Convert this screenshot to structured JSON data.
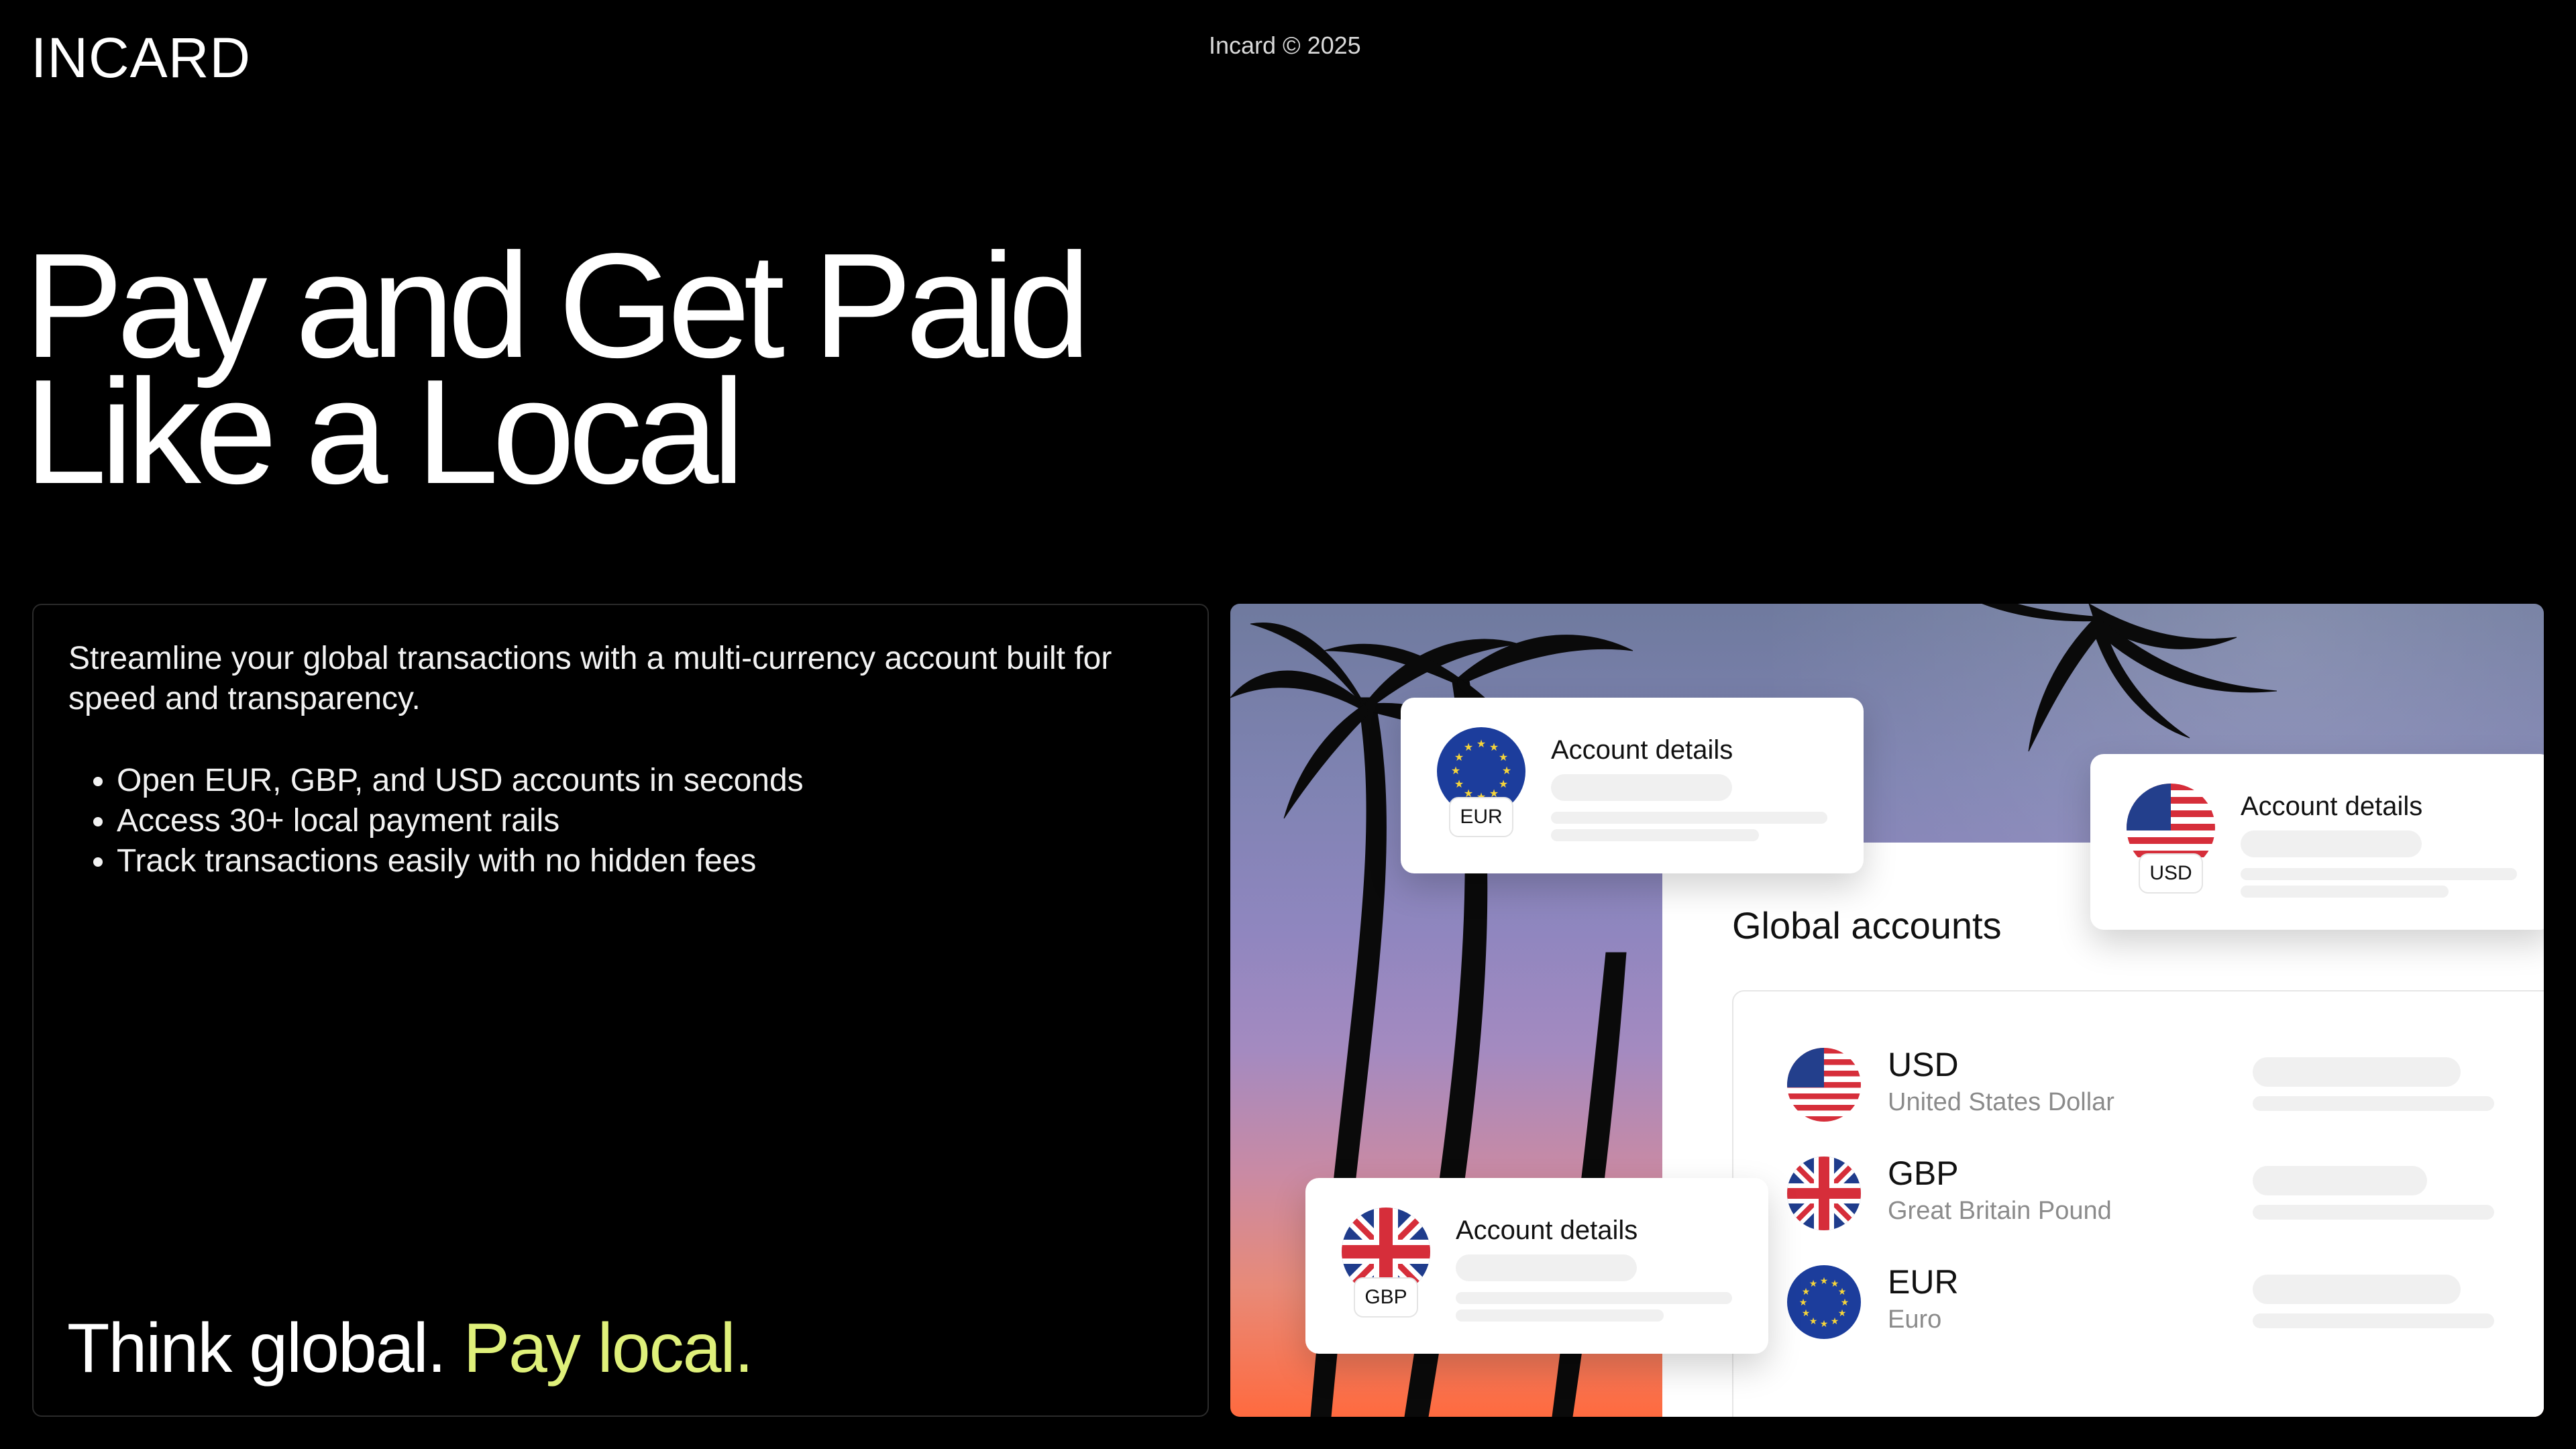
{
  "header": {
    "logo": "INCARD",
    "copyright": "Incard © 2025"
  },
  "hero": {
    "line1": "Pay and Get Paid",
    "line2": "Like a Local"
  },
  "left_card": {
    "intro": "Streamline your global transactions with a multi-currency account built for speed and transparency.",
    "features": [
      "Open EUR, GBP, and USD accounts in seconds",
      "Access 30+ local payment rails",
      "Track transactions easily with no hidden fees"
    ],
    "tagline_part1": "Think global.",
    "tagline_part2": "Pay local.",
    "accent_color": "#dff07a"
  },
  "visual": {
    "panel_title": "Global accounts",
    "accounts": [
      {
        "code": "USD",
        "name": "United States Dollar",
        "flag": "us-flag-icon"
      },
      {
        "code": "GBP",
        "name": "Great Britain Pound",
        "flag": "uk-flag-icon"
      },
      {
        "code": "EUR",
        "name": "Euro",
        "flag": "eu-flag-icon"
      }
    ],
    "float_cards": [
      {
        "title": "Account details",
        "currency": "EUR",
        "flag": "eu-flag-icon"
      },
      {
        "title": "Account details",
        "currency": "USD",
        "flag": "us-flag-icon"
      },
      {
        "title": "Account details",
        "currency": "GBP",
        "flag": "uk-flag-icon"
      }
    ]
  }
}
